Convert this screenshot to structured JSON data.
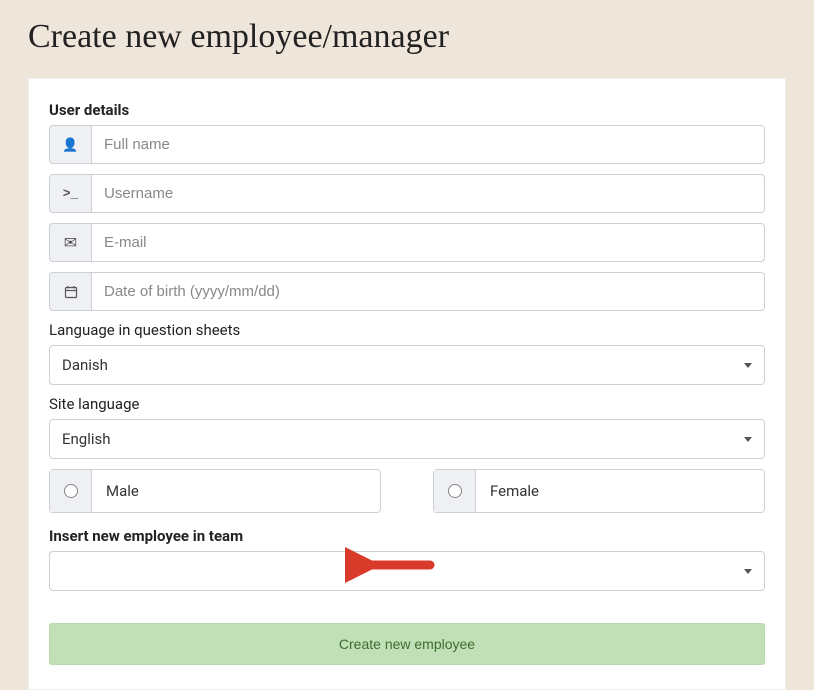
{
  "pageTitle": "Create new employee/manager",
  "section": {
    "userDetails": "User details",
    "fullNamePlaceholder": "Full name",
    "usernamePlaceholder": "Username",
    "emailPlaceholder": "E-mail",
    "dobPlaceholder": "Date of birth (yyyy/mm/dd)"
  },
  "languageSheets": {
    "label": "Language in question sheets",
    "value": "Danish"
  },
  "siteLanguage": {
    "label": "Site language",
    "value": "English"
  },
  "gender": {
    "male": "Male",
    "female": "Female"
  },
  "team": {
    "label": "Insert new employee in team",
    "value": ""
  },
  "submitLabel": "Create new employee",
  "icons": {
    "terminalGlyph": ">_"
  }
}
